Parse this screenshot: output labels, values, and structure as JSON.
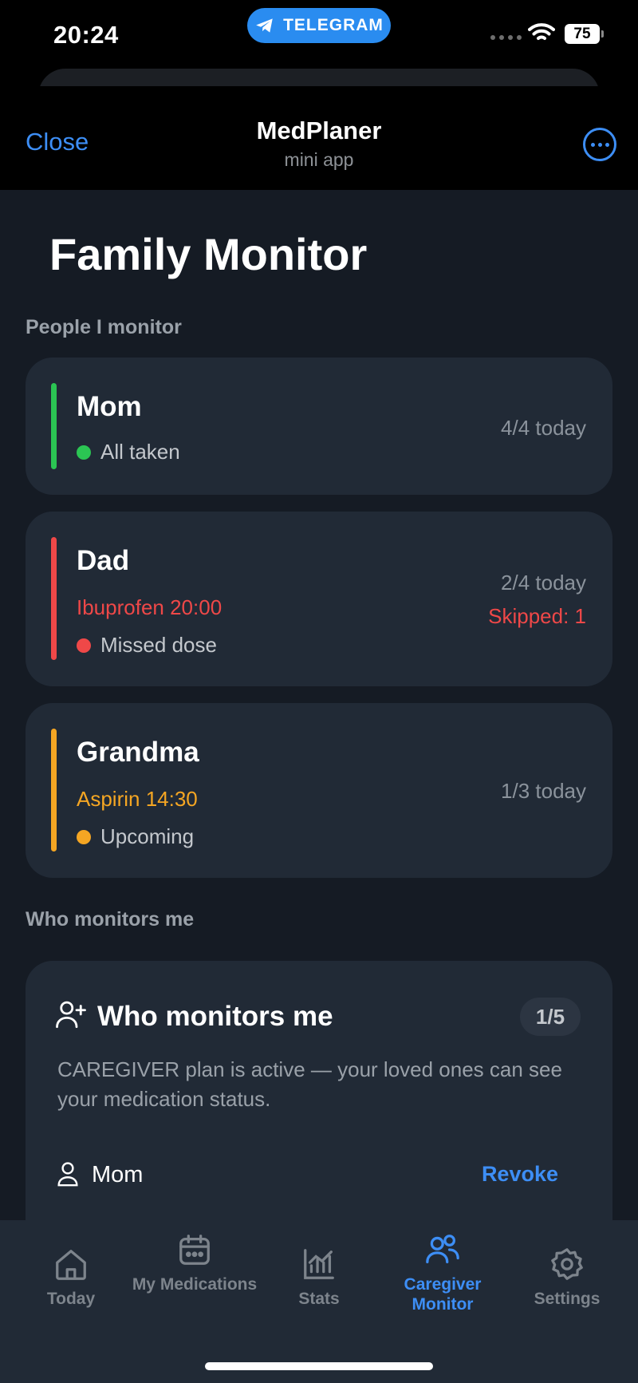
{
  "status_bar": {
    "time": "20:24",
    "pill_label": "TELEGRAM",
    "battery": "75"
  },
  "header": {
    "close": "Close",
    "title": "MedPlaner",
    "subtitle": "mini app"
  },
  "page": {
    "title": "Family Monitor"
  },
  "monitored": {
    "label": "People I monitor",
    "people": [
      {
        "name": "Mom",
        "status": "All taken",
        "count": "4/4 today",
        "color": "#2bc553"
      },
      {
        "name": "Dad",
        "medication": "Ibuprofen 20:00",
        "status": "Missed dose",
        "count": "2/4 today",
        "skipped": "Skipped: 1",
        "color": "#ef4848"
      },
      {
        "name": "Grandma",
        "medication": "Aspirin 14:30",
        "status": "Upcoming",
        "count": "1/3 today",
        "color": "#f5a623"
      }
    ]
  },
  "monitors_me": {
    "label": "Who monitors me",
    "card_title": "Who monitors me",
    "badge": "1/5",
    "description": "CAREGIVER plan is active — your loved ones can see your medication status.",
    "caregivers": [
      {
        "name": "Mom",
        "action": "Revoke"
      }
    ]
  },
  "tabs": [
    {
      "label": "Today",
      "icon": "home-icon"
    },
    {
      "label": "My Medications",
      "icon": "calendar-icon"
    },
    {
      "label": "Stats",
      "icon": "chart-icon"
    },
    {
      "label": "Caregiver Monitor",
      "icon": "users-icon",
      "active": true
    },
    {
      "label": "Settings",
      "icon": "gear-icon"
    }
  ],
  "colors": {
    "accent": "#3d8ef5",
    "background": "#151b24",
    "card": "#212a36"
  }
}
